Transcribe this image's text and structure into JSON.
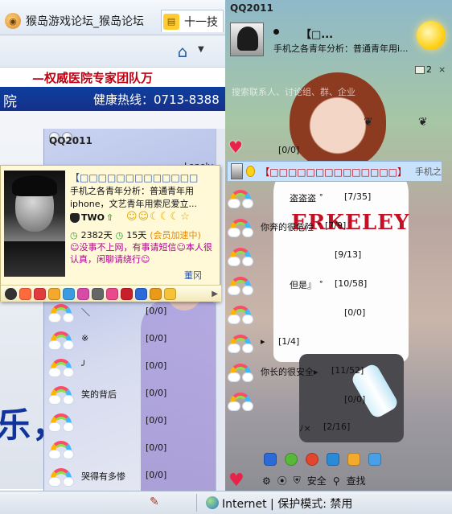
{
  "browser": {
    "tabs": [
      {
        "label": "猴岛游戏论坛_猴岛论坛",
        "icon": "monkey-icon"
      },
      {
        "label": "十一技",
        "icon": "note-icon"
      }
    ],
    "site": {
      "banner_text": "—权威医院专家团队万",
      "left_text": "院",
      "hotline": "健康热线：0713-8388",
      "big_text": "乐，音乐你的生"
    },
    "status": {
      "zone": "Internet | 保护模式: 禁用"
    }
  },
  "qq_mid": {
    "title": "QQ2011",
    "corner_text": "Lonely",
    "card": {
      "nickname": "【□□□□□□□□□□□□□",
      "signature": "手机之各青年分析：普通青年用iphone，文艺青年用索尼爱立...",
      "level_label": "TWO",
      "suns": "☺☺☾☾☾☆",
      "days_online": "2382天",
      "days_active": "15天",
      "speed_text": "(会员加速中)",
      "promo": "☺没事不上网，有事请短信☺本人很认真，闲聊请绕行☺",
      "tiny_name": "董冈"
    },
    "rows": [
      {
        "name": "＼",
        "count": "[0/0]"
      },
      {
        "name": "※",
        "count": "[0/0]"
      },
      {
        "name": "╯",
        "count": "[0/0]"
      },
      {
        "name": "笑的背后",
        "count": "[0/0]"
      },
      {
        "name": "",
        "count": "[0/0]"
      },
      {
        "name": "",
        "count": "[0/0]"
      },
      {
        "name": "哭得有多惨",
        "count": "[0/0]"
      }
    ],
    "extra_marks": {
      "mark1": "※",
      "mark2": "╯"
    }
  },
  "qq_right": {
    "title": "QQ2011",
    "nickname": "【□...",
    "signature": "手机之各青年分析：普通青年用i...",
    "count": "2",
    "faded_text": "搜索联系人、讨论组、群、企业",
    "group_header_count": "[0/0]",
    "selected": {
      "name": "【□□□□□□□□□□□□□□】",
      "sig": "手机之"
    },
    "rows": [
      {
        "name": "盗盗盗 ˚",
        "count": "[7/35]"
      },
      {
        "name": "你奔的很危险 ˚",
        "count": "[7/9]"
      },
      {
        "name": "",
        "count": "[9/13]"
      },
      {
        "name": "但是』 ˚",
        "count": "[10/58]"
      },
      {
        "name": "",
        "count": "[0/0]"
      },
      {
        "name": "▸",
        "count": "[1/4]"
      },
      {
        "name": "你长的很安全▸",
        "count": "[11/52]"
      },
      {
        "name": "",
        "count": "[0/0]"
      },
      {
        "name": "ﾉ×",
        "count": "[2/16]"
      }
    ],
    "bottom": {
      "security_label": "安全",
      "search_label": "查找"
    }
  }
}
